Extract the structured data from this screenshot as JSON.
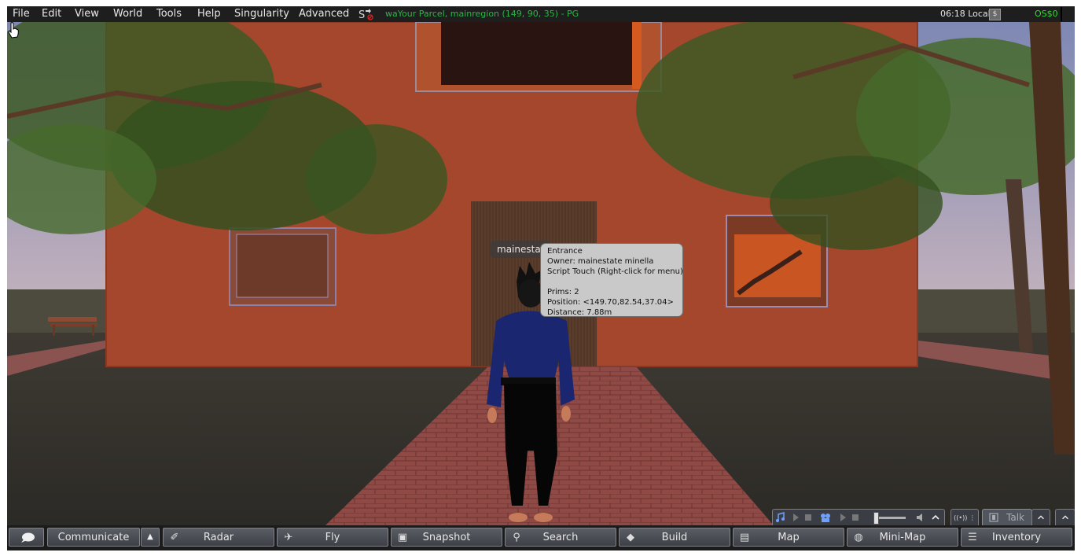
{
  "menubar": {
    "items": [
      "File",
      "Edit",
      "View",
      "World",
      "Tools",
      "Help",
      "Singularity",
      "Advanced"
    ],
    "location": "waYour Parcel, mainregion (149, 90, 35) - PG",
    "clock": "06:18 Local",
    "buy_icon": "$",
    "balance": "OS$0"
  },
  "scene": {
    "nametag": "mainestat",
    "tooltip": {
      "title": "Entrance",
      "owner": "Owner: mainestate minella",
      "action": "Script Touch (Right-click for menu)",
      "prims": "Prims: 2",
      "position": "Position: <149.70,82.54,37.04>",
      "distance": "Distance: 7.88m"
    }
  },
  "voice": {
    "settings_label": "((•)) ⋮",
    "talk_label": "Talk"
  },
  "toolbar": {
    "communicate": "Communicate",
    "radar": "Radar",
    "fly": "Fly",
    "snapshot": "Snapshot",
    "search": "Search",
    "build": "Build",
    "map": "Map",
    "minimap": "Mini-Map",
    "inventory": "Inventory"
  },
  "colors": {
    "location_text": "#2fb446",
    "balance_text": "#2fdc2f",
    "building": "#a4472c",
    "tooltip_bg": "#c9c9c9"
  },
  "icons": [
    "parcel-icon",
    "cursor-hand-icon",
    "chat-bubble-icon",
    "radar-icon",
    "fly-icon",
    "camera-icon",
    "magnifier-icon",
    "cube-icon",
    "map-icon",
    "globe-icon",
    "inventory-icon"
  ]
}
